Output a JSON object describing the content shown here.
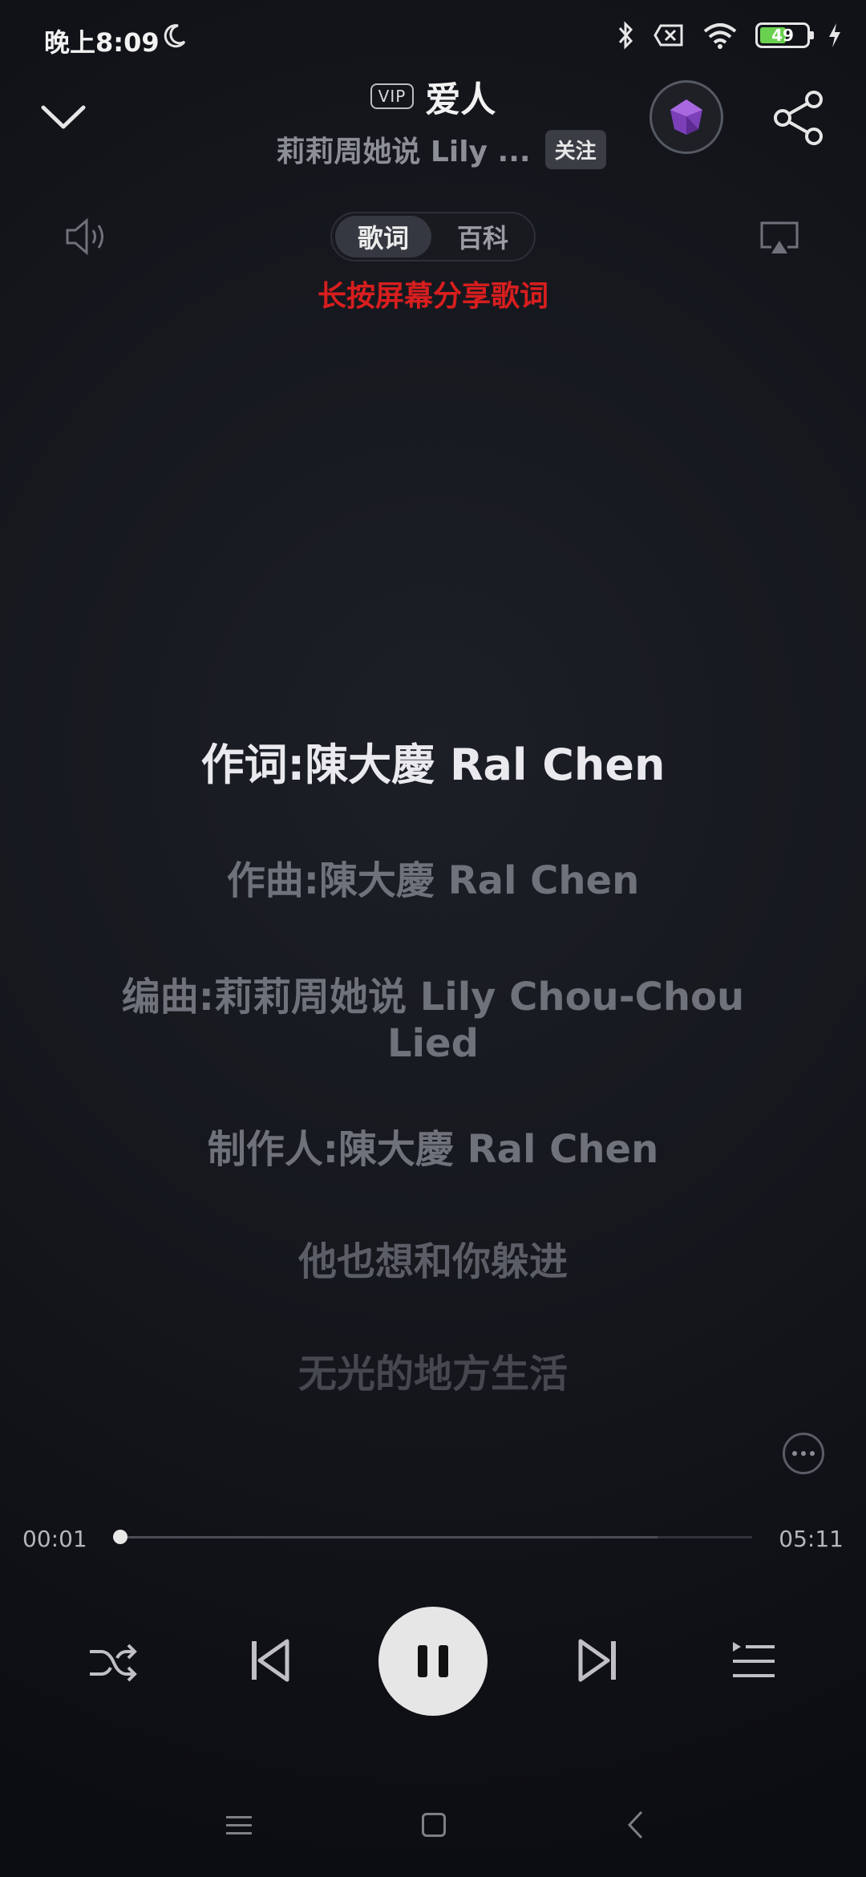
{
  "status": {
    "time": "晚上8:09",
    "battery": "49",
    "icons": [
      "moon-icon",
      "bluetooth-icon",
      "sim-off-icon",
      "wifi-icon",
      "battery-icon",
      "charging-icon"
    ]
  },
  "header": {
    "vip_badge": "VIP",
    "title": "爱人",
    "artist": "莉莉周她说 Lily ...",
    "follow_label": "关注"
  },
  "tabs": [
    {
      "label": "歌词",
      "active": true
    },
    {
      "label": "百科",
      "active": false
    }
  ],
  "share_hint": "长按屏幕分享歌词",
  "lyrics": [
    "作词:陳大慶 Ral Chen",
    "作曲:陳大慶 Ral Chen",
    "编曲:莉莉周她说 Lily Chou-Chou Lied",
    "制作人:陳大慶 Ral Chen",
    "他也想和你躲进",
    "无光的地方生活"
  ],
  "progress": {
    "current": "00:01",
    "total": "05:11",
    "played_fraction": 0.003,
    "buffered_fraction": 0.85
  },
  "colors": {
    "hint_red": "#d81e1e",
    "accent": "#e6e6e6"
  }
}
